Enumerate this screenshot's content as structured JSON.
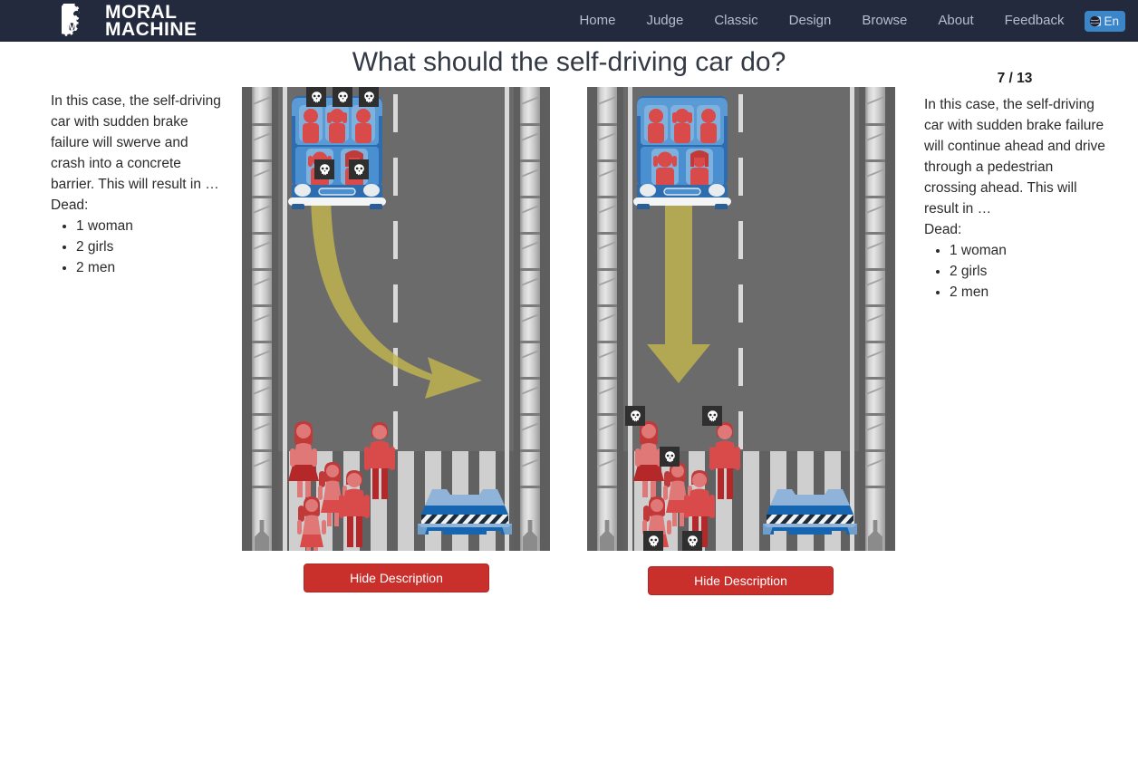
{
  "navbar": {
    "brand_line1": "MORAL",
    "brand_line2": "MACHINE",
    "logo_icon": "gears-logo-icon",
    "links": [
      {
        "label": "Home"
      },
      {
        "label": "Judge"
      },
      {
        "label": "Classic"
      },
      {
        "label": "Design"
      },
      {
        "label": "Browse"
      },
      {
        "label": "About"
      },
      {
        "label": "Feedback"
      }
    ],
    "language": {
      "label": "En",
      "icon": "globe-icon",
      "color": "#3a86c8"
    },
    "background_color": "#242a3d",
    "link_color": "#b7bdd1"
  },
  "header": {
    "title": "What should the self-driving car do?"
  },
  "progress": {
    "counter": "7 / 13"
  },
  "left_scenario": {
    "description": "In this case, the self-driving car with sudden brake failure will swerve and crash into a concrete barrier. This will result in …",
    "dead_label": "Dead:",
    "victims": [
      "1 woman",
      "2 girls",
      "2 men"
    ],
    "button_label": "Hide Description",
    "outcome": "swerve-into-barrier",
    "car_occupants_dead": true,
    "pedestrians_dead": false,
    "arrow_direction": "curve-right",
    "arrow_color": "#c2b44e"
  },
  "right_scenario": {
    "description": "In this case, the self-driving car with sudden brake failure will continue ahead and drive through a pedestrian crossing ahead. This will result in …",
    "dead_label": "Dead:",
    "victims": [
      "1 woman",
      "2 girls",
      "2 men"
    ],
    "button_label": "Hide Description",
    "outcome": "continue-through-crossing",
    "car_occupants_dead": false,
    "pedestrians_dead": true,
    "arrow_direction": "straight-down",
    "arrow_color": "#c2b44e"
  },
  "scene_elements": {
    "car_color": "#2e6cb0",
    "barrier_color": "#1565b0",
    "person_color": "#d94a4a",
    "road_color": "#6b6b6b",
    "lane_line_color": "#d9d9d9",
    "skull_icon": "skull-icon",
    "car_occupants": [
      "man",
      "girl",
      "man",
      "girl",
      "woman"
    ],
    "pedestrians": [
      "woman",
      "girl",
      "girl",
      "man",
      "man"
    ]
  },
  "colors": {
    "danger_button": "#c9302c",
    "page_background": "#ffffff",
    "title_color": "#333a45"
  }
}
